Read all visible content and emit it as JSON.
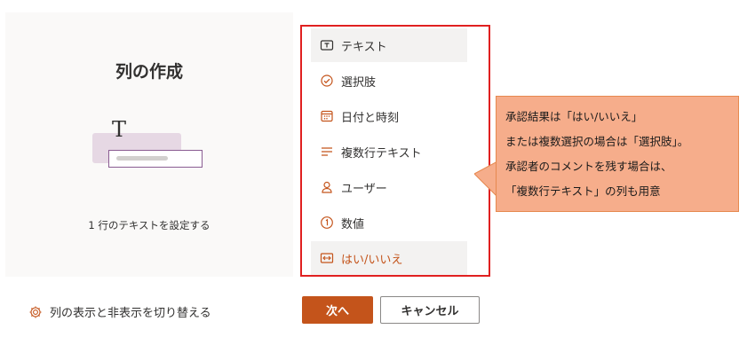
{
  "panel": {
    "title": "列の作成",
    "description": "1 行のテキストを設定する"
  },
  "column_types": [
    {
      "label": "テキスト",
      "icon": "text-icon"
    },
    {
      "label": "選択肢",
      "icon": "choice-icon"
    },
    {
      "label": "日付と時刻",
      "icon": "calendar-icon"
    },
    {
      "label": "複数行テキスト",
      "icon": "multiline-text-icon"
    },
    {
      "label": "ユーザー",
      "icon": "person-icon"
    },
    {
      "label": "数値",
      "icon": "number-icon"
    },
    {
      "label": "はい/いいえ",
      "icon": "yes-no-icon"
    }
  ],
  "callout": {
    "lines": [
      "承認結果は「はい/いいえ」",
      "または複数選択の場合は「選択肢」。",
      "承認者のコメントを残す場合は、",
      "「複数行テキスト」の列も用意"
    ]
  },
  "footer": {
    "toggle_label": "列の表示と非表示を切り替える",
    "next_label": "次へ",
    "cancel_label": "キャンセル"
  },
  "colors": {
    "accent": "#c4541b",
    "highlight_border": "#e02020",
    "callout_fill": "#f6ad8b"
  }
}
